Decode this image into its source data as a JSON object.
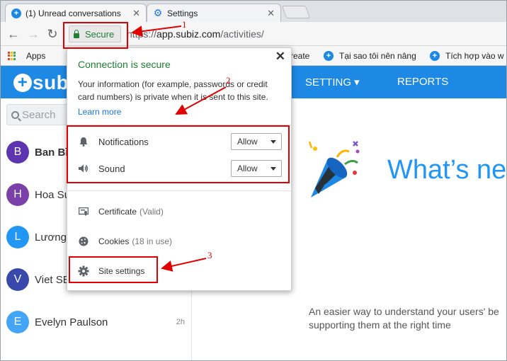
{
  "browser": {
    "tabs": [
      {
        "label": "(1) Unread conversations"
      },
      {
        "label": "Settings"
      }
    ],
    "secure_label": "Secure",
    "url_scheme": "https://",
    "url_host": "app.subiz.com",
    "url_path": "/activities/",
    "bookmarks": [
      {
        "label": "Apps"
      },
      {
        "label": "reate"
      },
      {
        "label": "Tại sao tôi nên nâng"
      },
      {
        "label": "Tích hợp vào w"
      }
    ]
  },
  "app": {
    "logo_text": "sub",
    "nav": [
      {
        "label": "SETTING ▾"
      },
      {
        "label": "REPORTS"
      }
    ],
    "search_placeholder": "Search",
    "conversations": [
      {
        "initial": "B",
        "name": "Ban Bì",
        "color": "#5e35b1",
        "bold": true,
        "time": ""
      },
      {
        "initial": "H",
        "name": "Hoa Su",
        "color": "#7b3fa8",
        "bold": false,
        "time": ""
      },
      {
        "initial": "L",
        "name": "Lương",
        "color": "#2196f3",
        "bold": false,
        "time": ""
      },
      {
        "initial": "V",
        "name": "Viet SE",
        "color": "#3949ab",
        "bold": false,
        "time": ""
      },
      {
        "initial": "E",
        "name": "Evelyn Paulson",
        "color": "#42a5f5",
        "bold": false,
        "time": "2h"
      }
    ],
    "whats_new": "What’s ne",
    "description_line1": "An easier way to understand your users' be",
    "description_line2": "supporting them at the right time"
  },
  "popup": {
    "title": "Connection is secure",
    "body": "Your information (for example, passwords or credit card numbers) is private when it is sent to this site.",
    "learn_more": "Learn more",
    "permissions": [
      {
        "icon": "bell-icon",
        "label": "Notifications",
        "value": "Allow"
      },
      {
        "icon": "speaker-icon",
        "label": "Sound",
        "value": "Allow"
      }
    ],
    "certificate_label": "Certificate",
    "certificate_status": "(Valid)",
    "cookies_label": "Cookies",
    "cookies_status": "(18 in use)",
    "site_settings": "Site settings",
    "close_symbol": "✕"
  },
  "annotations": {
    "one": "1",
    "two": "2",
    "three": "3",
    "color": "#e00000"
  }
}
